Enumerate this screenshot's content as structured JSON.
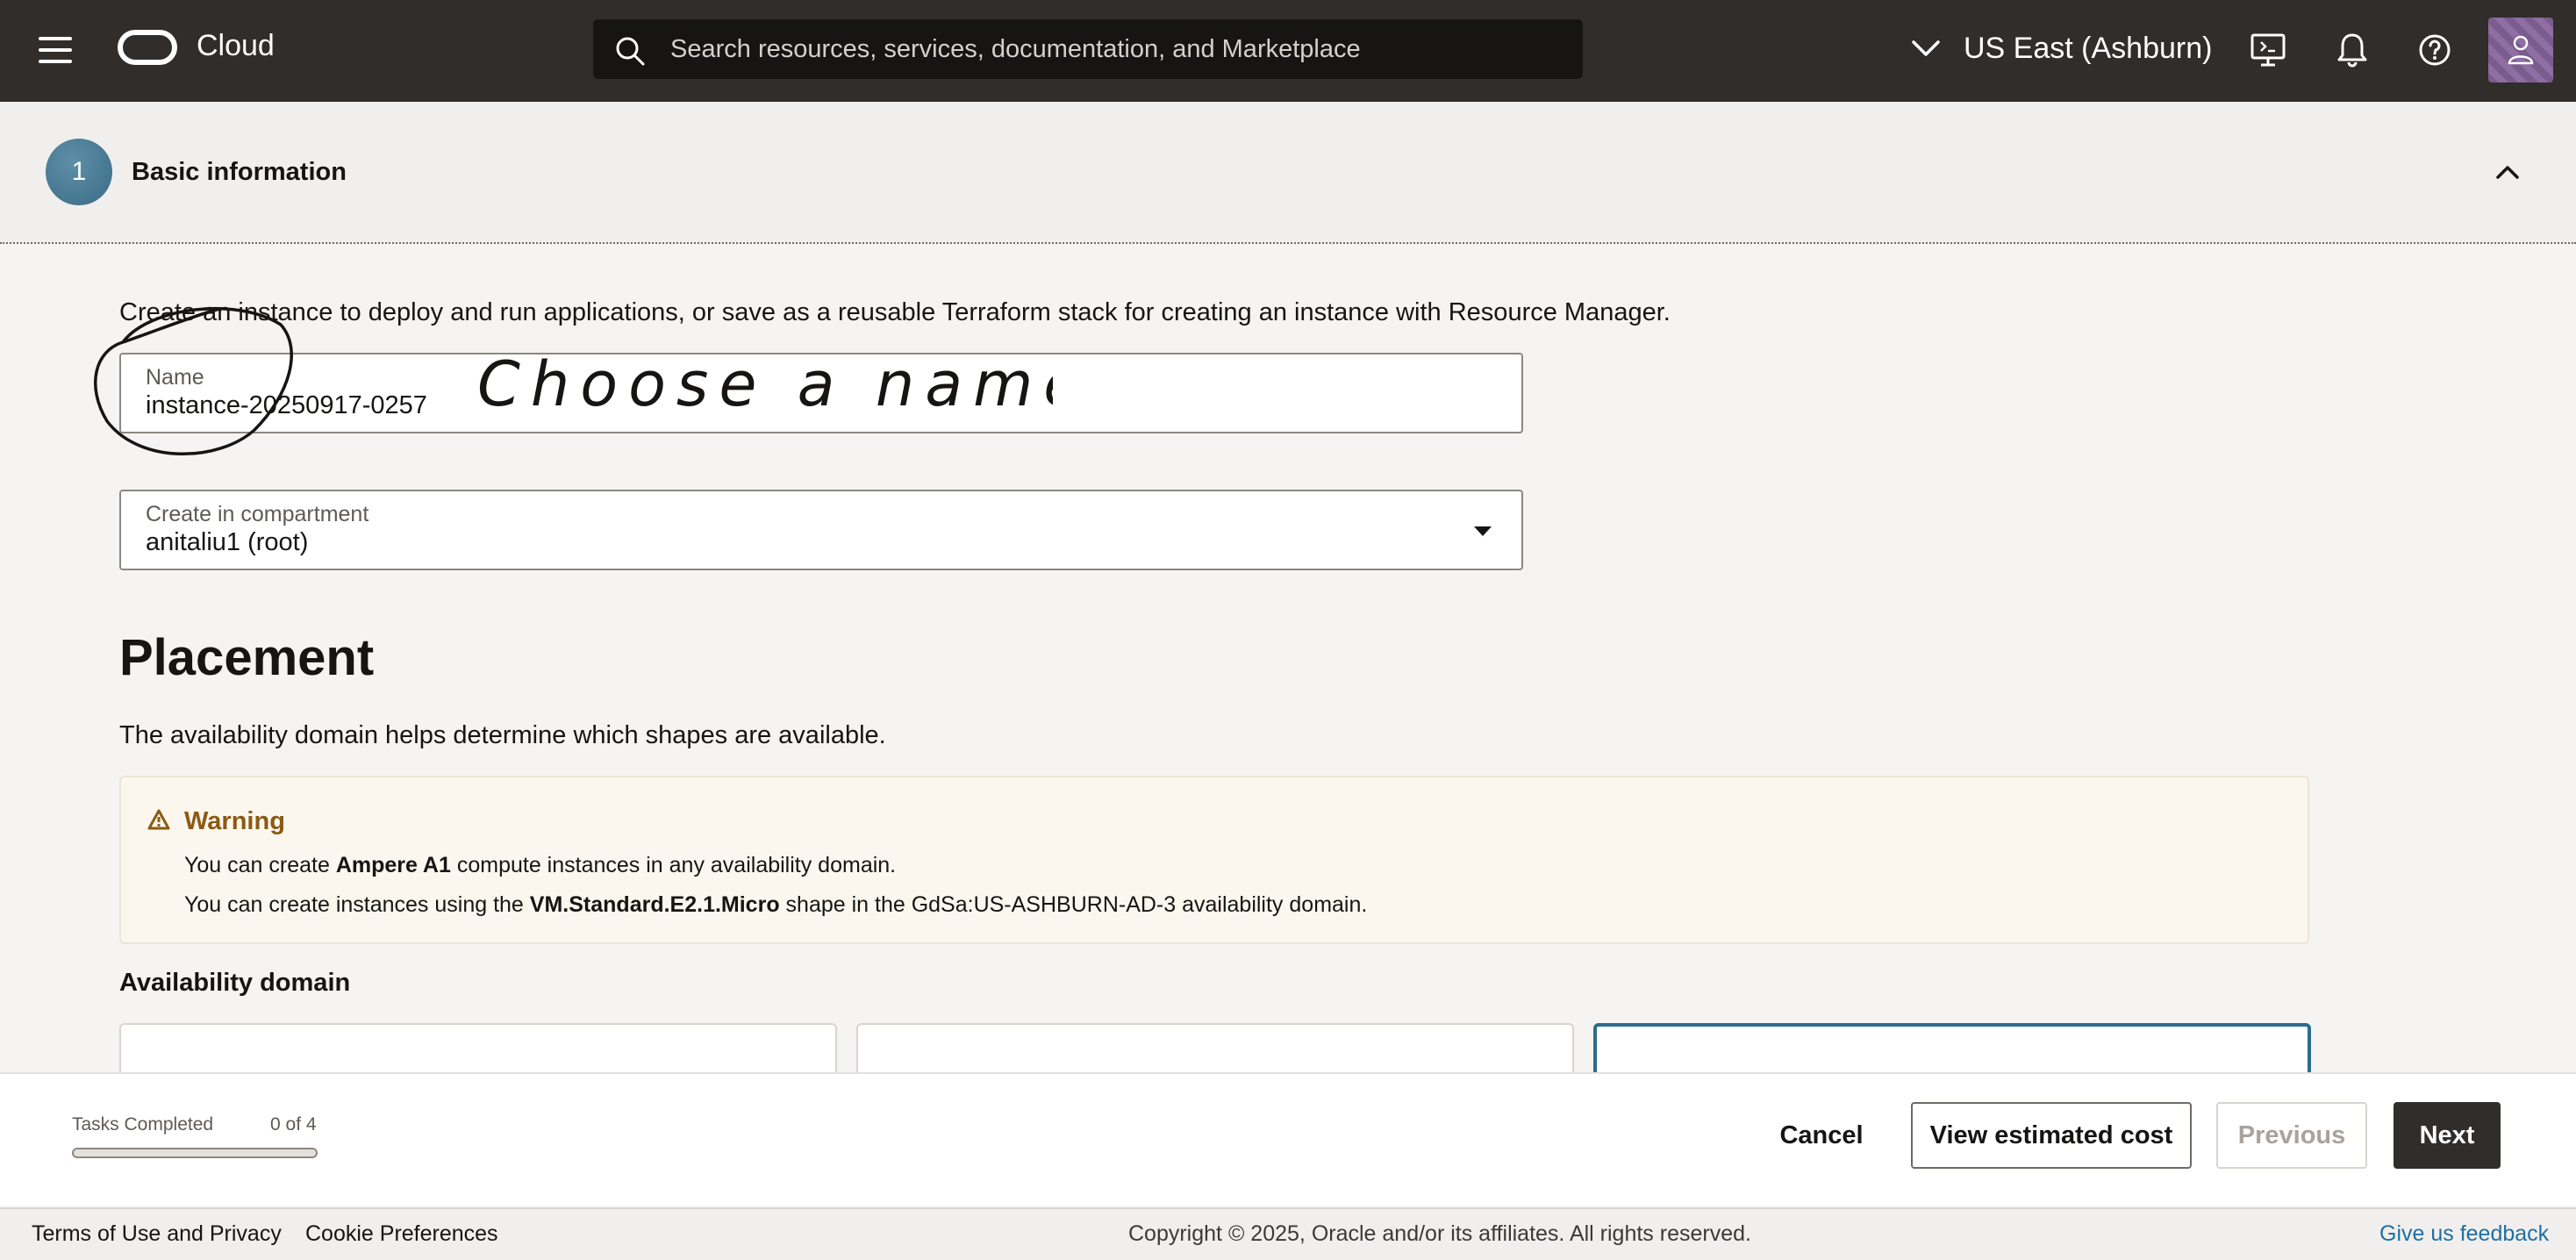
{
  "header": {
    "brand": "Cloud",
    "search_placeholder": "Search resources, services, documentation, and Marketplace",
    "region": "US East (Ashburn)",
    "icons": [
      "menu-icon",
      "oracle-logo-icon",
      "search-icon",
      "chevron-down-icon",
      "cloud-shell-icon",
      "bell-icon",
      "help-icon",
      "user-icon"
    ]
  },
  "section": {
    "step_number": "1",
    "title": "Basic information"
  },
  "form": {
    "intro": "Create an instance to deploy and run applications, or save as a reusable Terraform stack for creating an instance with Resource Manager.",
    "name_label": "Name",
    "name_value": "instance-20250917-0257",
    "compartment_label": "Create in compartment",
    "compartment_value": "anitaliu1 (root)",
    "annotation": "Choose a name"
  },
  "placement": {
    "title": "Placement",
    "description": "The availability domain helps determine which shapes are available.",
    "warning": {
      "title": "Warning",
      "line1_prefix": "You can create ",
      "line1_bold": "Ampere A1",
      "line1_suffix": " compute instances in any availability domain.",
      "line2_prefix": "You can create instances using the ",
      "line2_bold": "VM.Standard.E2.1.Micro",
      "line2_suffix": " shape in the GdSa:US-ASHBURN-AD-3 availability domain."
    },
    "availability_domain_label": "Availability domain"
  },
  "actionbar": {
    "tasks_label": "Tasks Completed",
    "tasks_count": "0 of 4",
    "tasks_progress": 0,
    "cancel": "Cancel",
    "view_cost": "View estimated cost",
    "previous": "Previous",
    "next": "Next"
  },
  "footer": {
    "terms": "Terms of Use and Privacy",
    "cookies": "Cookie Preferences",
    "copyright": "Copyright © 2025, Oracle and/or its affiliates. All rights reserved.",
    "feedback": "Give us feedback"
  },
  "colors": {
    "header_bg": "#312d2a",
    "accent": "#2c6c8f",
    "warning_text": "#8b5a13",
    "link": "#1f6fa3"
  }
}
